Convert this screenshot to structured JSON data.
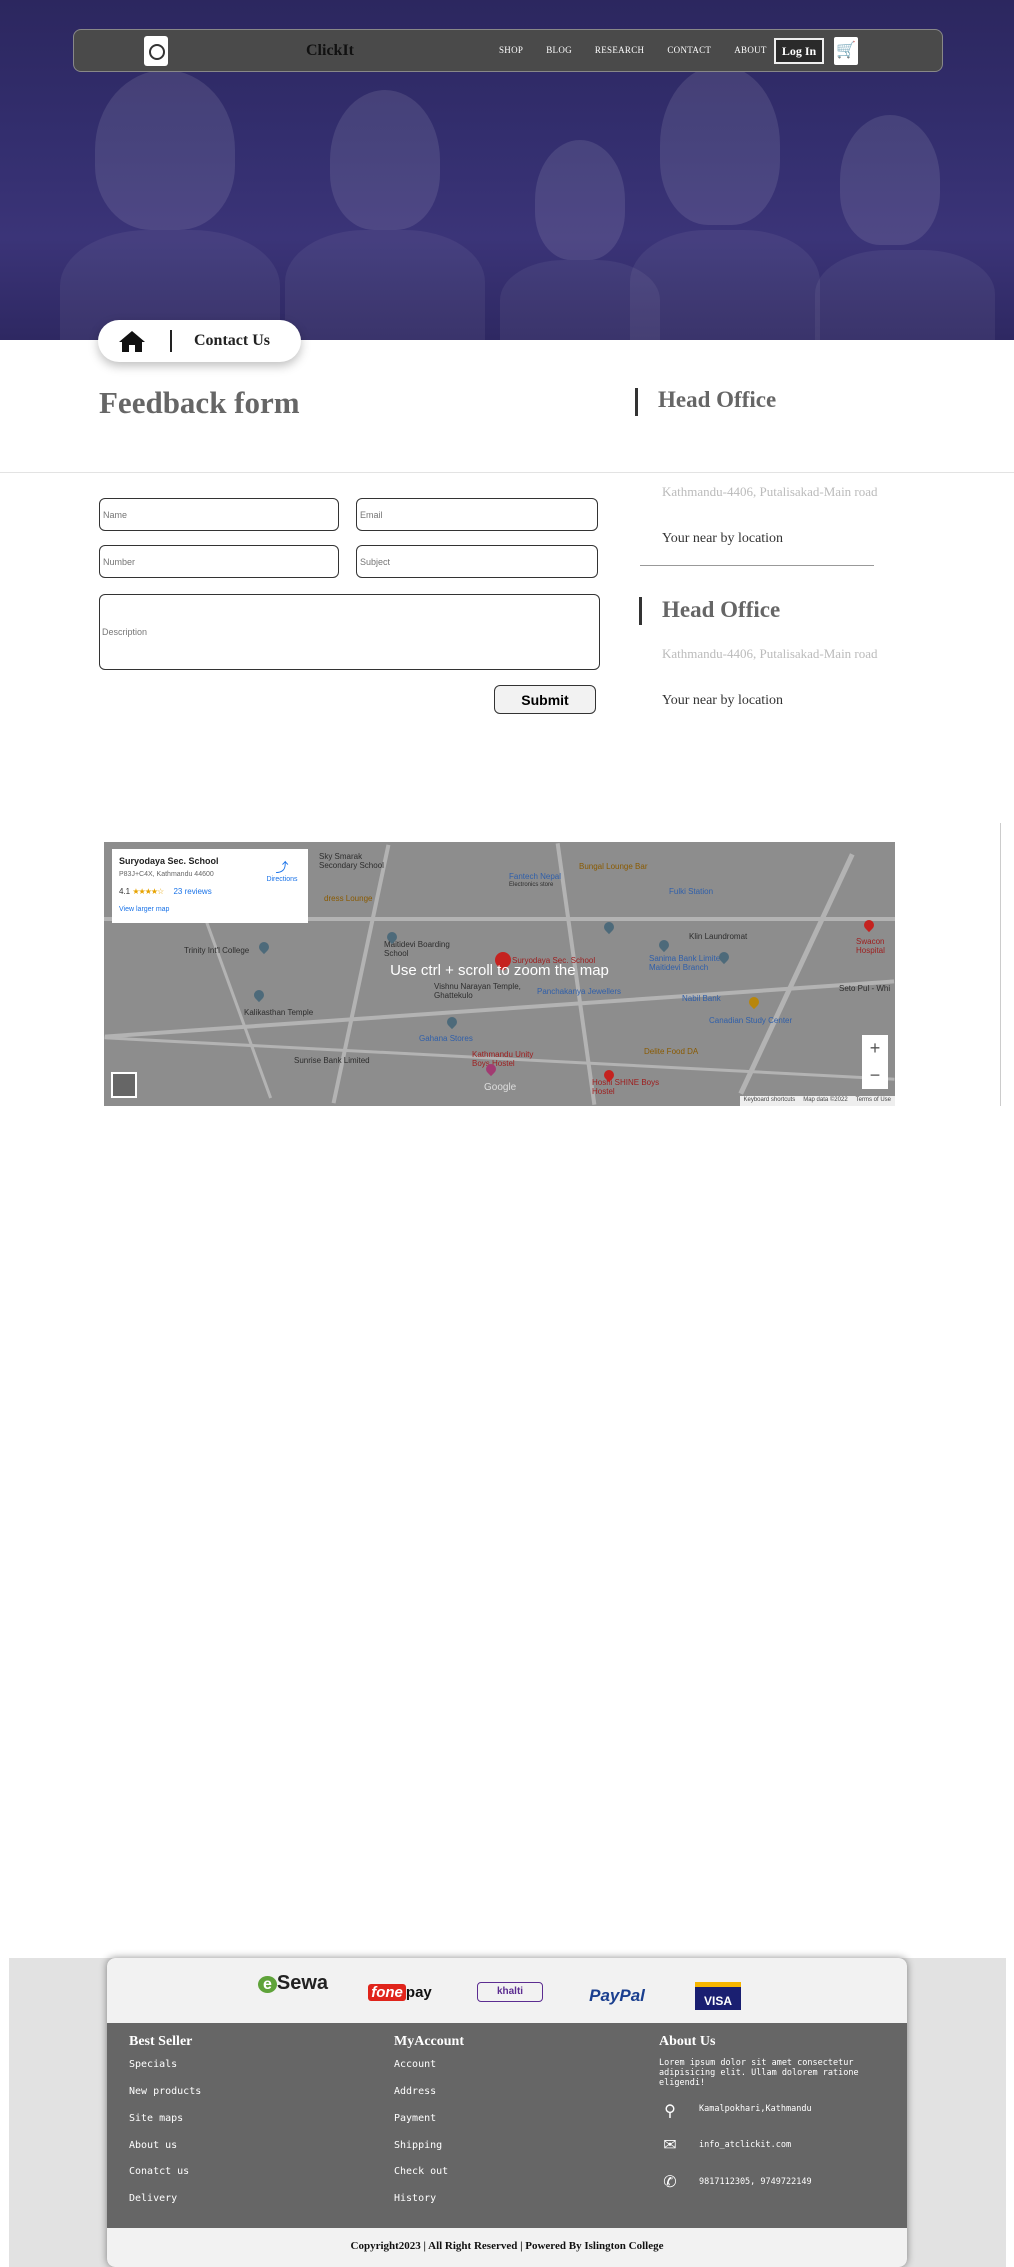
{
  "nav": {
    "brand": "ClickIt",
    "menu": [
      "SHOP",
      "BLOG",
      "RESEARCH",
      "CONTACT",
      "ABOUT"
    ],
    "login": "Log In",
    "logo_icon": "logo-icon",
    "cart_icon": "cart-icon"
  },
  "breadcrumb": {
    "home_icon": "home-icon",
    "label": "Contact Us"
  },
  "form": {
    "title": "Feedback form",
    "name_placeholder": "Name",
    "email_placeholder": "Email",
    "number_placeholder": "Number",
    "subject_placeholder": "Subject",
    "description_placeholder": "Description",
    "submit": "Submit"
  },
  "offices": [
    {
      "title": "Head Office",
      "address": "Kathmandu-4406, Putalisakad-Main road",
      "near": "Your near by location"
    },
    {
      "title": "Head Office",
      "address": "Kathmandu-4406, Putalisakad-Main road",
      "near": "Your near by location"
    }
  ],
  "map": {
    "place_name": "Suryodaya Sec. School",
    "place_address": "P83J+C4X, Kathmandu 44600",
    "rating": "4.1",
    "stars": "★★★★☆",
    "reviews": "23 reviews",
    "view_larger": "View larger map",
    "directions": "Directions",
    "hint": "Use ctrl + scroll to zoom the map",
    "zoom_in": "+",
    "zoom_out": "−",
    "attribution": [
      "Keyboard shortcuts",
      "Map data ©2022",
      "Terms of Use"
    ],
    "google": "Google",
    "labels": {
      "l1": "Fantech Nepal",
      "l2": "Electronics store",
      "l3": "Fulki Station",
      "l4": "Bungal Lounge Bar",
      "l5": "Trinity Int'l College",
      "l6": "Maitidevi Boarding School",
      "l7": "Suryodaya Sec. School",
      "l8": "Vishnu Narayan Temple, Ghattekulo",
      "l9": "Panchakanya Jewellers",
      "l10": "Kalikasthan Temple",
      "l11": "Gahana Stores",
      "l12": "Sunrise Bank Limited",
      "l13": "Kathmandu Unity Boys Hostel",
      "l14": "Hoshi SHINE Boys Hostel",
      "l15": "Klin Laundromat",
      "l16": "Sanima Bank Limited, Maitidevi Branch",
      "l17": "Nabil Bank",
      "l18": "Canadian Study Center",
      "l19": "Delite Food DA",
      "l20": "Swacon Hospital",
      "l21": "Seto Pul - Whi",
      "l22": "dress Lounge",
      "l23": "Sky Smarak Secondary School"
    }
  },
  "footer": {
    "payments": {
      "esewa_mark": "e",
      "esewa": "Sewa",
      "fone_mark": "fone",
      "fone": "pay",
      "khalti": "khalti",
      "paypal": "PayPal",
      "visa": "VISA"
    },
    "best_seller": {
      "title": "Best Seller",
      "items": [
        "Specials",
        "New products",
        "Site maps",
        "About us",
        "Conatct us",
        "Delivery"
      ]
    },
    "my_account": {
      "title": "MyAccount",
      "items": [
        "Account",
        "Address",
        "Payment",
        "Shipping",
        "Check out",
        "History"
      ]
    },
    "about": {
      "title": "About Us",
      "text": "Lorem ipsum dolor sit amet consectetur adipisicing elit. Ullam dolorem ratione eligendi!",
      "address": "Kamalpokhari,Kathmandu",
      "email": "info_atclickit.com",
      "phone": "9817112305, 9749722149"
    },
    "copyright": "Copyright2023 | All Right Reserved | Powered By Islington College"
  }
}
